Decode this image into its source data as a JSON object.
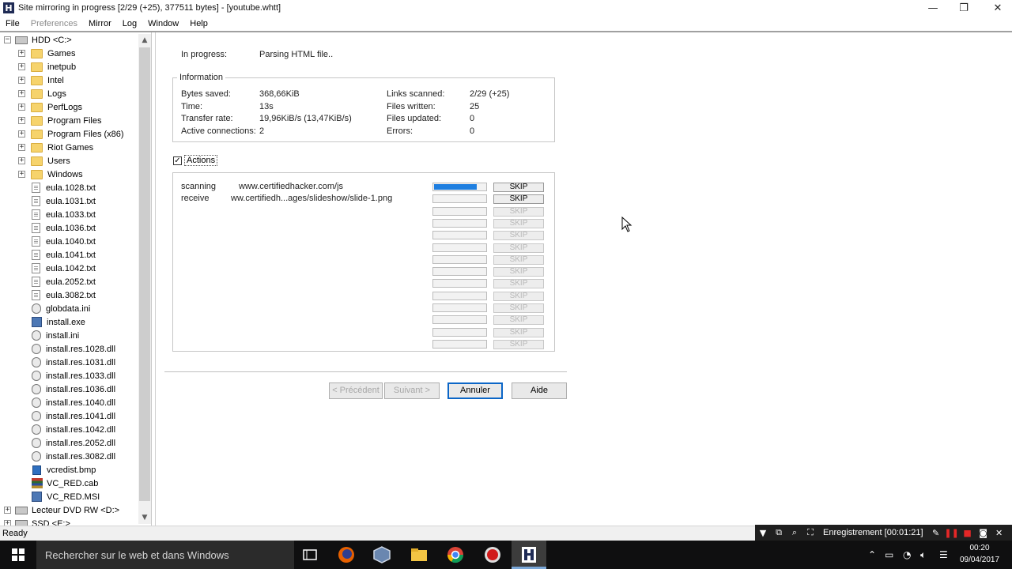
{
  "window": {
    "title": "Site mirroring in progress [2/29 (+25), 377511 bytes] - [youtube.whtt]",
    "icon_letter": "H",
    "minimize": "—",
    "restore": "❐",
    "close": "✕"
  },
  "menu": [
    {
      "label": "File",
      "enabled": true
    },
    {
      "label": "Preferences",
      "enabled": false
    },
    {
      "label": "Mirror",
      "enabled": true
    },
    {
      "label": "Log",
      "enabled": true
    },
    {
      "label": "Window",
      "enabled": true
    },
    {
      "label": "Help",
      "enabled": true
    }
  ],
  "tree": {
    "root": "HDD <C:>",
    "folders": [
      "Games",
      "inetpub",
      "Intel",
      "Logs",
      "PerfLogs",
      "Program Files",
      "Program Files (x86)",
      "Riot Games",
      "Users",
      "Windows"
    ],
    "files": [
      {
        "name": "eula.1028.txt",
        "icon": "text-file"
      },
      {
        "name": "eula.1031.txt",
        "icon": "text-file"
      },
      {
        "name": "eula.1033.txt",
        "icon": "text-file"
      },
      {
        "name": "eula.1036.txt",
        "icon": "text-file"
      },
      {
        "name": "eula.1040.txt",
        "icon": "text-file"
      },
      {
        "name": "eula.1041.txt",
        "icon": "text-file"
      },
      {
        "name": "eula.1042.txt",
        "icon": "text-file"
      },
      {
        "name": "eula.2052.txt",
        "icon": "text-file"
      },
      {
        "name": "eula.3082.txt",
        "icon": "text-file"
      },
      {
        "name": "globdata.ini",
        "icon": "settings-file"
      },
      {
        "name": "install.exe",
        "icon": "executable"
      },
      {
        "name": "install.ini",
        "icon": "settings-file"
      },
      {
        "name": "install.res.1028.dll",
        "icon": "settings-file"
      },
      {
        "name": "install.res.1031.dll",
        "icon": "settings-file"
      },
      {
        "name": "install.res.1033.dll",
        "icon": "settings-file"
      },
      {
        "name": "install.res.1036.dll",
        "icon": "settings-file"
      },
      {
        "name": "install.res.1040.dll",
        "icon": "settings-file"
      },
      {
        "name": "install.res.1041.dll",
        "icon": "settings-file"
      },
      {
        "name": "install.res.1042.dll",
        "icon": "settings-file"
      },
      {
        "name": "install.res.2052.dll",
        "icon": "settings-file"
      },
      {
        "name": "install.res.3082.dll",
        "icon": "settings-file"
      },
      {
        "name": "vcredist.bmp",
        "icon": "bitmap"
      },
      {
        "name": "VC_RED.cab",
        "icon": "cabinet"
      },
      {
        "name": "VC_RED.MSI",
        "icon": "executable"
      }
    ],
    "drives": [
      "Lecteur DVD RW <D:>",
      "SSD <E:>"
    ]
  },
  "progress": {
    "label": "In progress:",
    "value": "Parsing HTML file.."
  },
  "information": {
    "title": "Information",
    "left": [
      {
        "label": "Bytes saved:",
        "value": "368,66KiB"
      },
      {
        "label": "Time:",
        "value": "13s"
      },
      {
        "label": "Transfer rate:",
        "value": "19,96KiB/s (13,47KiB/s)"
      },
      {
        "label": "Active connections:",
        "value": "2"
      }
    ],
    "right": [
      {
        "label": "Links scanned:",
        "value": "2/29 (+25)"
      },
      {
        "label": "Files written:",
        "value": "25"
      },
      {
        "label": "Files updated:",
        "value": "0"
      },
      {
        "label": "Errors:",
        "value": "0"
      }
    ]
  },
  "actions": {
    "label": "Actions",
    "checked": true,
    "check_mark": "✓",
    "rows": [
      {
        "action": "scanning",
        "url": "www.certifiedhacker.com/js",
        "progress": 0.8,
        "skip": "SKIP",
        "enabled": true
      },
      {
        "action": "receive",
        "url": "ww.certifiedh...ages/slideshow/slide-1.png",
        "progress": 0,
        "skip": "SKIP",
        "enabled": true
      },
      {
        "action": "",
        "url": "",
        "progress": 0,
        "skip": "SKIP",
        "enabled": false
      },
      {
        "action": "",
        "url": "",
        "progress": 0,
        "skip": "SKIP",
        "enabled": false
      },
      {
        "action": "",
        "url": "",
        "progress": 0,
        "skip": "SKIP",
        "enabled": false
      },
      {
        "action": "",
        "url": "",
        "progress": 0,
        "skip": "SKIP",
        "enabled": false
      },
      {
        "action": "",
        "url": "",
        "progress": 0,
        "skip": "SKIP",
        "enabled": false
      },
      {
        "action": "",
        "url": "",
        "progress": 0,
        "skip": "SKIP",
        "enabled": false
      },
      {
        "action": "",
        "url": "",
        "progress": 0,
        "skip": "SKIP",
        "enabled": false
      },
      {
        "action": "",
        "url": "",
        "progress": 0,
        "skip": "SKIP",
        "enabled": false
      },
      {
        "action": "",
        "url": "",
        "progress": 0,
        "skip": "SKIP",
        "enabled": false
      },
      {
        "action": "",
        "url": "",
        "progress": 0,
        "skip": "SKIP",
        "enabled": false
      },
      {
        "action": "",
        "url": "",
        "progress": 0,
        "skip": "SKIP",
        "enabled": false
      },
      {
        "action": "",
        "url": "",
        "progress": 0,
        "skip": "SKIP",
        "enabled": false
      }
    ]
  },
  "wizard": {
    "previous": "< Précédent",
    "next": "Suivant >",
    "cancel": "Annuler",
    "help": "Aide"
  },
  "status": "Ready",
  "recorder": {
    "label": "Enregistrement [00:01:21]"
  },
  "taskbar": {
    "search_placeholder": "Rechercher sur le web et dans Windows",
    "time": "00:20",
    "date": "09/04/2017"
  },
  "colors": {
    "progress_fill": "#1f7fe0",
    "default_button_border": "#0b66c7",
    "taskbar": "#0f0f10"
  }
}
